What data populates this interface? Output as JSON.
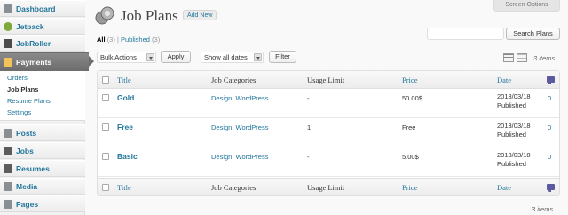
{
  "sidebar": {
    "items": [
      {
        "label": "Dashboard"
      },
      {
        "label": "Jetpack"
      },
      {
        "label": "JobRoller"
      },
      {
        "label": "Payments"
      },
      {
        "label": "Posts"
      },
      {
        "label": "Jobs"
      },
      {
        "label": "Resumes"
      },
      {
        "label": "Media"
      },
      {
        "label": "Pages"
      }
    ],
    "submenu": [
      "Orders",
      "Job Plans",
      "Resume Plans",
      "Settings"
    ]
  },
  "header": {
    "title": "Job Plans",
    "add_new": "Add New",
    "screen_options": "Screen Options"
  },
  "filters": {
    "all_label": "All",
    "all_count": "(3)",
    "separator": "|",
    "published_label": "Published",
    "published_count": "(3)"
  },
  "search": {
    "placeholder": "",
    "button": "Search Plans"
  },
  "toolbar": {
    "bulk_actions": "Bulk Actions",
    "apply": "Apply",
    "dates": "Show all dates",
    "filter": "Filter",
    "items_count": "3 items"
  },
  "table": {
    "columns": [
      "Title",
      "Job Categories",
      "Usage Limit",
      "Price",
      "Date"
    ],
    "rows": [
      {
        "title": "Gold",
        "categories": "Design, WordPress",
        "usage": "-",
        "price": "50.00$",
        "date": "2013/03/18",
        "status": "Published"
      },
      {
        "title": "Free",
        "categories": "Design, WordPress",
        "usage": "1",
        "price": "Free",
        "date": "2013/03/18",
        "status": "Published"
      },
      {
        "title": "Basic",
        "categories": "Design, WordPress",
        "usage": "-",
        "price": "5.00$",
        "date": "2013/03/18",
        "status": "Published"
      }
    ]
  },
  "colors": {
    "link": "#21759b",
    "active_menu": "#6d6d6d",
    "accent_icon": "#5a5a9e"
  }
}
